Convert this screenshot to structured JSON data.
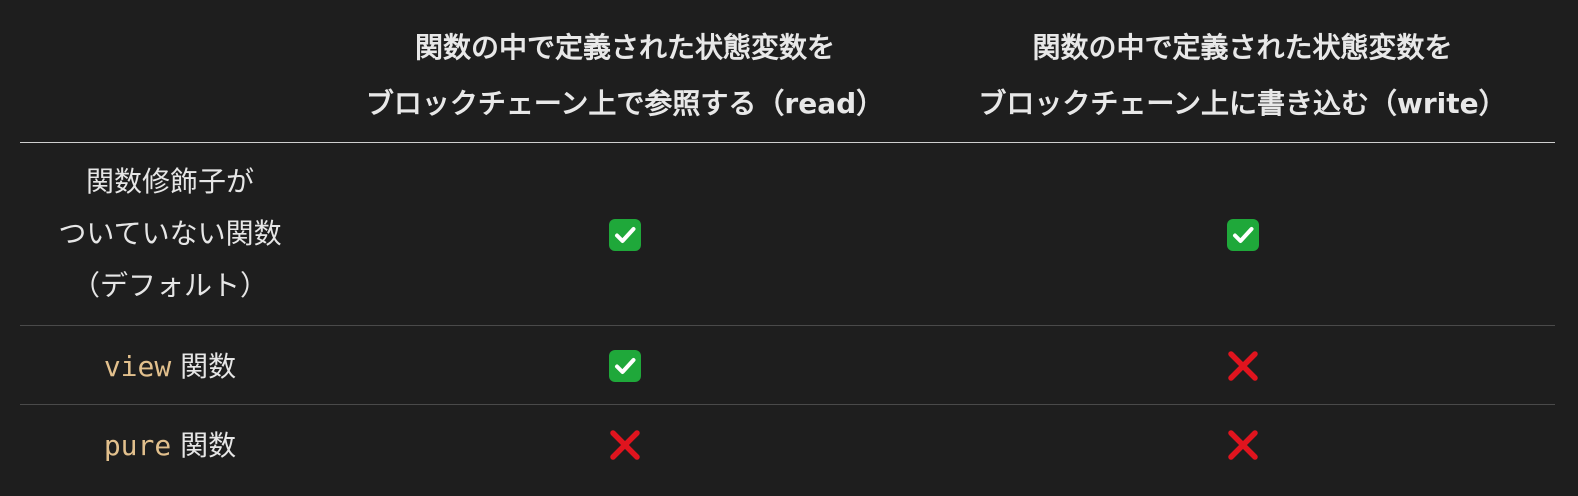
{
  "header": {
    "col2_line1": "関数の中で定義された状態変数を",
    "col2_line2": "ブロックチェーン上で参照する（read）",
    "col3_line1": "関数の中で定義された状態変数を",
    "col3_line2": "ブロックチェーン上に書き込む（write）"
  },
  "rows": [
    {
      "label_line1": "関数修飾子が",
      "label_line2": "ついていない関数",
      "label_line3": "（デフォルト）",
      "read": "check",
      "write": "check"
    },
    {
      "code": "view",
      "label": " 関数",
      "read": "check",
      "write": "cross"
    },
    {
      "code": "pure",
      "label": " 関数",
      "read": "cross",
      "write": "cross"
    }
  ],
  "colors": {
    "background": "#1e1e1e",
    "code": "#e2c08d",
    "check": "#1fa83a",
    "cross": "#e0141e"
  }
}
